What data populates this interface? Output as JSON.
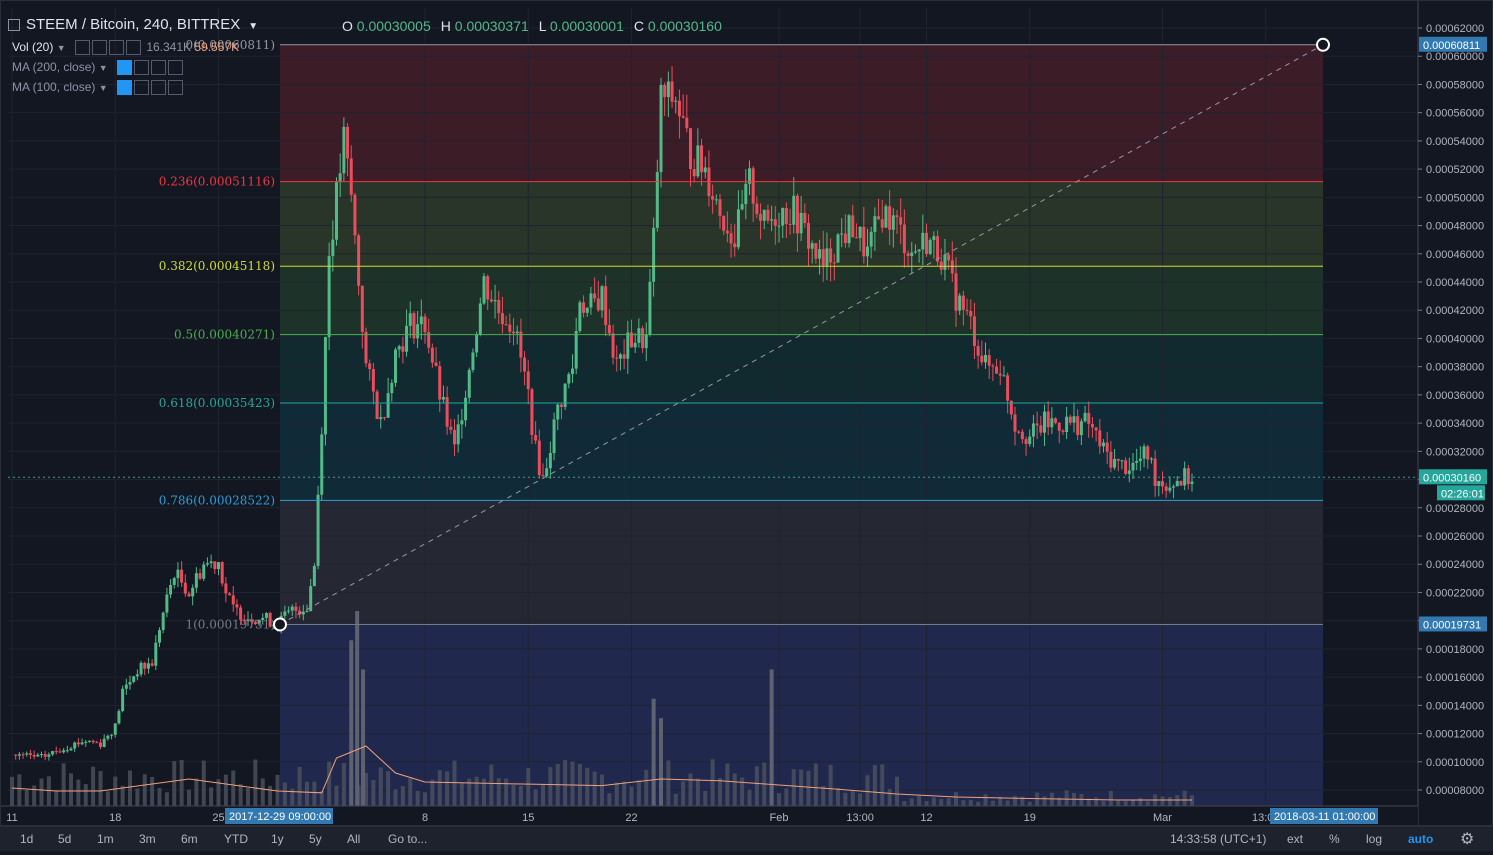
{
  "header": {
    "symbol_label": "STEEM / Bitcoin, 240, BITTREX",
    "ohlc": [
      {
        "key": "O",
        "value": "0.00030005"
      },
      {
        "key": "H",
        "value": "0.00030371"
      },
      {
        "key": "L",
        "value": "0.00030001"
      },
      {
        "key": "C",
        "value": "0.00030160"
      }
    ]
  },
  "indicators": [
    {
      "label": "Vol (20)",
      "value": "16.341K",
      "value2": "59.557K"
    },
    {
      "label": "MA (200, close)"
    },
    {
      "label": "MA (100, close)"
    }
  ],
  "toolbar": {
    "ranges": [
      "1d",
      "5d",
      "1m",
      "3m",
      "6m",
      "YTD",
      "1y",
      "5y",
      "All"
    ],
    "goto": "Go to...",
    "clock": "14:33:58 (UTC+1)",
    "ext": "ext",
    "percent": "%",
    "log": "log",
    "auto": "auto"
  },
  "colors": {
    "background": "#131722",
    "up": "#53b987",
    "down": "#eb4d5c",
    "volume": "#4e5260",
    "volume_ma": "#f0a07a",
    "price_tag_bg": "#26a69a",
    "time_tag_bg": "#3179b0"
  },
  "chart_data": {
    "type": "candlestick",
    "symbol": "STEEM / Bitcoin",
    "interval": "240",
    "exchange": "BITTREX",
    "yaxis_scale": "linear",
    "ylim": [
      7e-05,
      0.00063
    ],
    "y_ticks": [
      "0.00062000",
      "0.00060000",
      "0.00058000",
      "0.00056000",
      "0.00054000",
      "0.00052000",
      "0.00050000",
      "0.00048000",
      "0.00046000",
      "0.00044000",
      "0.00042000",
      "0.00040000",
      "0.00038000",
      "0.00036000",
      "0.00034000",
      "0.00032000",
      "0.00030000",
      "0.00028000",
      "0.00026000",
      "0.00024000",
      "0.00022000",
      "0.00020000",
      "0.00018000",
      "0.00016000",
      "0.00014000",
      "0.00012000",
      "0.00010000",
      "0.00008000"
    ],
    "x_ticks": [
      "11",
      "18",
      "25",
      "8",
      "15",
      "22",
      "Feb",
      "13:00",
      "12",
      "19",
      "Mar",
      "13:00"
    ],
    "x_tick_positions": [
      0.0,
      7,
      14,
      28,
      35,
      42,
      52,
      57.5,
      62,
      69,
      78,
      85
    ],
    "x_range": [
      0,
      90
    ],
    "last_price": {
      "value": 0.0003016,
      "label": "0.00030160",
      "countdown": "02:26:01"
    },
    "range_start_label": "2017-12-29 09:00:00",
    "range_end_label": "2018-03-11 01:00:00",
    "fibonacci": {
      "start_point": {
        "x": 18.0,
        "price": 0.00019731
      },
      "end_point": {
        "x": 89.0,
        "price": 0.00060811
      },
      "start_label": "0.00019731",
      "end_label": "0.00060811",
      "levels": [
        {
          "ratio": "0",
          "price": 0.00060811,
          "label": "0(0.00060811)",
          "color": "#9598a1",
          "fill": "rgba(242,54,69,0.18)"
        },
        {
          "ratio": "0.236",
          "price": 0.00051116,
          "label": "0.236(0.00051116)",
          "color": "#f23645",
          "fill": "rgba(139,195,74,0.18)"
        },
        {
          "ratio": "0.382",
          "price": 0.00045118,
          "label": "0.382(0.00045118)",
          "color": "#cddc39",
          "fill": "rgba(76,175,80,0.18)"
        },
        {
          "ratio": "0.5",
          "price": 0.00040271,
          "label": "0.5(0.00040271)",
          "color": "#4caf50",
          "fill": "rgba(8,153,129,0.15)"
        },
        {
          "ratio": "0.618",
          "price": 0.00035423,
          "label": "0.618(0.00035423)",
          "color": "#26a69a",
          "fill": "rgba(0,188,212,0.12)"
        },
        {
          "ratio": "0.786",
          "price": 0.00028522,
          "label": "0.786(0.00028522)",
          "color": "#2a9fd6",
          "fill": "rgba(120,123,134,0.18)"
        },
        {
          "ratio": "1",
          "price": 0.00019731,
          "label": "1(0.00019731)",
          "color": "#787b86",
          "fill": "rgba(63,81,181,0.30)"
        }
      ]
    },
    "price_path_x": [
      0,
      2,
      4,
      5,
      6,
      7,
      7.5,
      8.5,
      9.5,
      10,
      11,
      12,
      13,
      14,
      14.5,
      15,
      16,
      17,
      18,
      19,
      20,
      20.5,
      21,
      21.5,
      22,
      22.5,
      23,
      23.5,
      24,
      25,
      26,
      27,
      28,
      29,
      30,
      31,
      32,
      33,
      34,
      35,
      35.5,
      36,
      37,
      38,
      38.5,
      39,
      40,
      41,
      42,
      43,
      43.5,
      44,
      45,
      46,
      47,
      48,
      49,
      50,
      51,
      52,
      53,
      54,
      55,
      56,
      57,
      58,
      59,
      60,
      61,
      62,
      63,
      64,
      65,
      66,
      67,
      68,
      69,
      70,
      71,
      72,
      73,
      74,
      75,
      76,
      77,
      77.5,
      78,
      78.5,
      79,
      80
    ],
    "price_path_y": [
      0.000105,
      0.000103,
      0.000112,
      0.000115,
      0.000113,
      0.000125,
      0.00015,
      0.000165,
      0.00017,
      0.000195,
      0.000235,
      0.00022,
      0.00024,
      0.000242,
      0.00022,
      0.000208,
      0.000203,
      0.000202,
      0.000198,
      0.000207,
      0.00021,
      0.00024,
      0.00034,
      0.00046,
      0.0005,
      0.00054,
      0.0005,
      0.00044,
      0.00038,
      0.00034,
      0.00039,
      0.00041,
      0.00041,
      0.00036,
      0.00032,
      0.00038,
      0.00044,
      0.00042,
      0.00041,
      0.00036,
      0.00032,
      0.0003,
      0.00035,
      0.00038,
      0.00043,
      0.00042,
      0.00043,
      0.00038,
      0.0004,
      0.0004,
      0.00047,
      0.00057,
      0.00057,
      0.00053,
      0.00052,
      0.00049,
      0.00047,
      0.00051,
      0.00048,
      0.00049,
      0.00049,
      0.00047,
      0.00045,
      0.00047,
      0.00048,
      0.00046,
      0.00049,
      0.00048,
      0.00046,
      0.00047,
      0.00046,
      0.00043,
      0.00041,
      0.00038,
      0.00038,
      0.00034,
      0.00033,
      0.00034,
      0.00034,
      0.00034,
      0.00034,
      0.00032,
      0.00031,
      0.00031,
      0.000318,
      0.000302,
      0.000298,
      0.000297,
      0.0003,
      0.0003016
    ],
    "volume_ma_path_x": [
      0,
      3,
      6,
      9,
      12,
      15,
      18,
      21,
      22,
      24,
      26,
      28,
      32,
      36,
      40,
      44,
      48,
      52,
      56,
      60,
      64,
      70,
      75,
      80
    ],
    "volume_ma_path_y": [
      0.3,
      0.25,
      0.25,
      0.35,
      0.45,
      0.35,
      0.25,
      0.22,
      0.8,
      1.0,
      0.55,
      0.4,
      0.38,
      0.36,
      0.34,
      0.45,
      0.42,
      0.35,
      0.28,
      0.2,
      0.15,
      0.12,
      0.1,
      0.1
    ],
    "volume_spikes_x": [
      23.0,
      23.4,
      23.8,
      43.5,
      44.0,
      51.5
    ],
    "volume_spikes_h": [
      0.85,
      1.0,
      0.7,
      0.55,
      0.45,
      0.7
    ]
  }
}
